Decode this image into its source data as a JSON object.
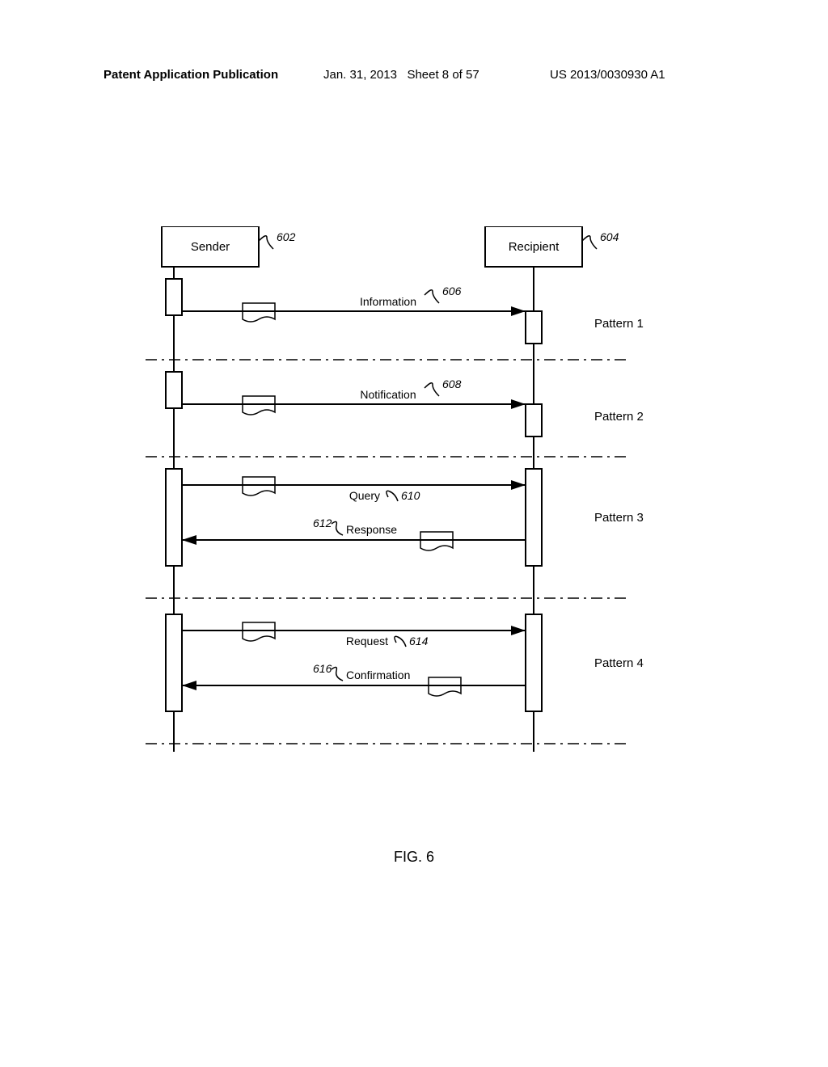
{
  "header": {
    "left": "Patent Application Publication",
    "mid_date": "Jan. 31, 2013",
    "mid_sheet": "Sheet 8 of 57",
    "right": "US 2013/0030930 A1"
  },
  "diagram": {
    "sender_label": "Sender",
    "recipient_label": "Recipient",
    "sender_ref": "602",
    "recipient_ref": "604",
    "patterns": [
      {
        "name": "Pattern 1",
        "messages": [
          {
            "label": "Information",
            "ref": "606",
            "dir": "right"
          }
        ]
      },
      {
        "name": "Pattern 2",
        "messages": [
          {
            "label": "Notification",
            "ref": "608",
            "dir": "right"
          }
        ]
      },
      {
        "name": "Pattern 3",
        "messages": [
          {
            "label": "Query",
            "ref": "610",
            "dir": "right"
          },
          {
            "label": "Response",
            "ref": "612",
            "dir": "left"
          }
        ]
      },
      {
        "name": "Pattern 4",
        "messages": [
          {
            "label": "Request",
            "ref": "614",
            "dir": "right"
          },
          {
            "label": "Confirmation",
            "ref": "616",
            "dir": "left"
          }
        ]
      }
    ]
  },
  "figure_caption": "FIG. 6"
}
